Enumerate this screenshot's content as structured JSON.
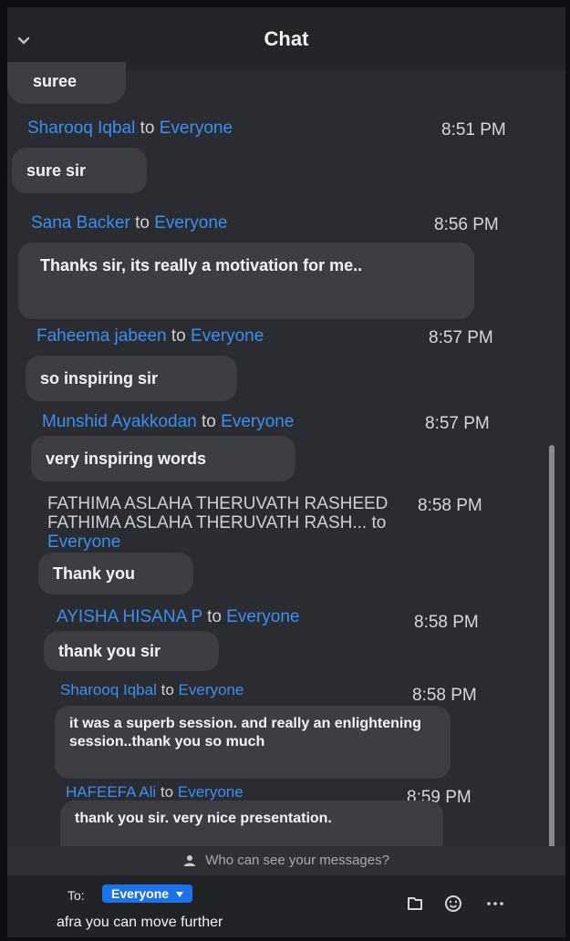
{
  "header": {
    "title": "Chat",
    "collapse_icon": "chevron-down-icon"
  },
  "messages": [
    {
      "text": "suree"
    },
    {
      "sender": "Sharooq Iqbal",
      "to": "to",
      "recipient": "Everyone",
      "time": "8:51 PM",
      "text": "sure sir"
    },
    {
      "sender": "Sana Backer",
      "to": "to",
      "recipient": "Everyone",
      "time": "8:56 PM",
      "text": "Thanks sir, its really a motivation for me.."
    },
    {
      "sender": "Faheema jabeen",
      "to": "to",
      "recipient": "Everyone",
      "time": "8:57 PM",
      "text": "so inspiring sir"
    },
    {
      "sender": "Munshid Ayakkodan",
      "to": "to",
      "recipient": "Everyone",
      "time": "8:57 PM",
      "text": "very inspiring words"
    },
    {
      "sender": "FATHIMA ASLAHA THERUVATH RASHEED FATHIMA ASLAHA THERUVATH RASH...",
      "to": "to",
      "recipient": "Everyone",
      "time": "8:58 PM",
      "text": "Thank you"
    },
    {
      "sender": "AYISHA HISANA P",
      "to": "to",
      "recipient": "Everyone",
      "time": "8:58 PM",
      "text": "thank you sir"
    },
    {
      "sender": "Sharooq Iqbal",
      "to": "to",
      "recipient": "Everyone",
      "time": "8:58 PM",
      "text": "it was a superb session. and really an enlightening session..thank you so much"
    },
    {
      "sender": "HAFEEFA Ali",
      "to": "to",
      "recipient": "Everyone",
      "time": "8:59 PM",
      "text": "thank you sir. very nice presentation."
    }
  ],
  "privacy_notice": {
    "icon": "person-icon",
    "text": "Who can see your messages?"
  },
  "composer": {
    "to_label": "To:",
    "recipient": "Everyone",
    "recipient_icon": "caret-down-icon",
    "input_value": "afra you can move further",
    "file_icon": "file-icon",
    "emoji_icon": "emoji-icon",
    "more_icon": "more-icon"
  }
}
